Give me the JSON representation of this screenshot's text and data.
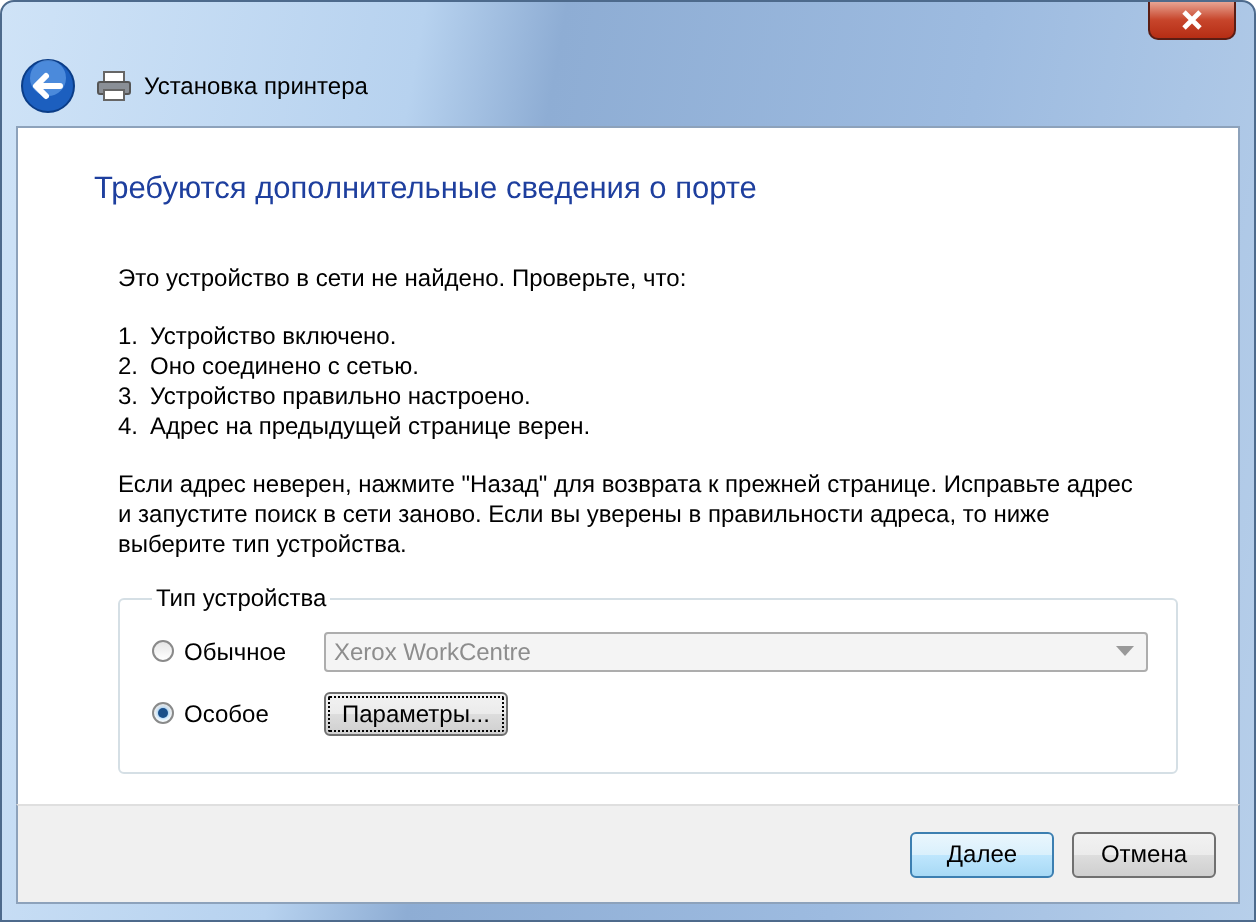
{
  "window": {
    "title": "Установка принтера"
  },
  "heading": "Требуются дополнительные сведения о порте",
  "intro": "Это устройство в сети не найдено. Проверьте, что:",
  "checks": [
    {
      "number": "1.",
      "text": "Устройство включено."
    },
    {
      "number": "2.",
      "text": "Оно соединено с сетью."
    },
    {
      "number": "3.",
      "text": "Устройство правильно настроено."
    },
    {
      "number": "4.",
      "text": "Адрес на предыдущей странице верен."
    }
  ],
  "advice": "Если адрес неверен, нажмите \"Назад\" для возврата к прежней странице.  Исправьте адрес и запустите поиск в сети заново.  Если вы уверены в правильности адреса, то ниже выберите тип устройства.",
  "device_type": {
    "legend": "Тип устройства",
    "options": [
      {
        "label": "Обычное",
        "selected": false,
        "kind": "dropdown",
        "value": "Xerox WorkCentre",
        "disabled": true
      },
      {
        "label": "Особое",
        "selected": true,
        "kind": "button",
        "button": "Параметры..."
      }
    ]
  },
  "buttons": [
    {
      "label": "Далее",
      "default": true
    },
    {
      "label": "Отмена",
      "default": false
    }
  ]
}
